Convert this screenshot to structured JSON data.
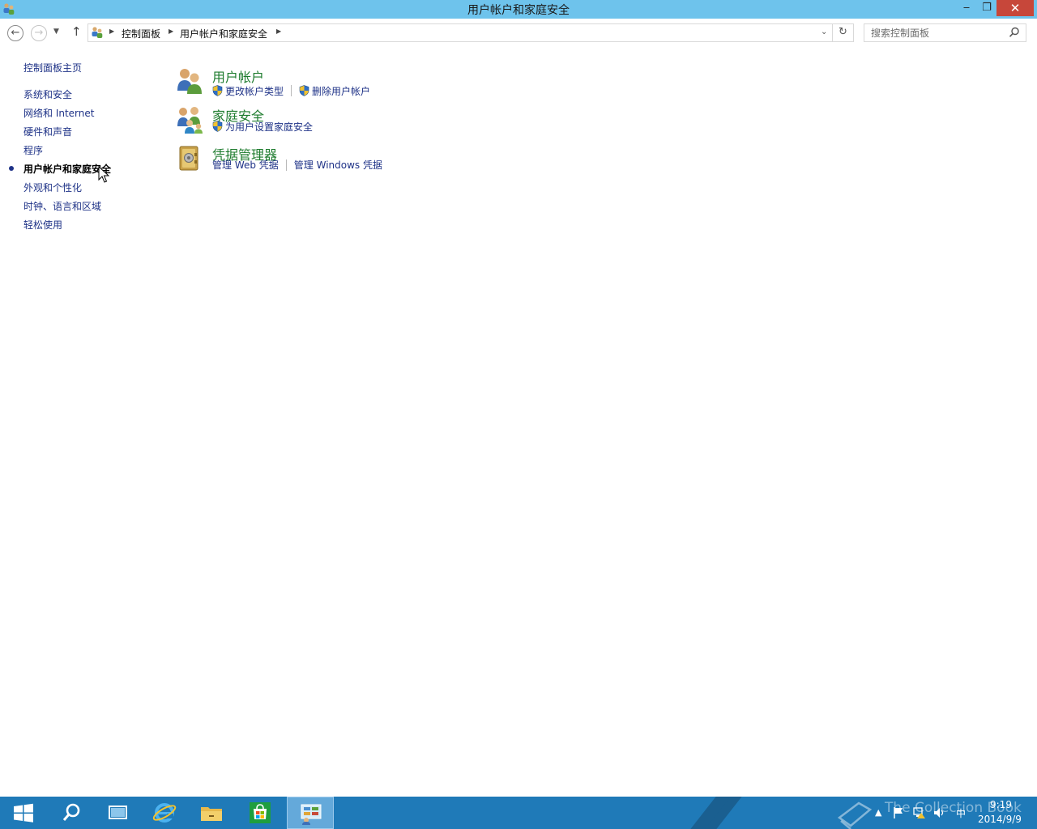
{
  "window": {
    "title": "用户帐户和家庭安全",
    "controls": {
      "minimize": "‒",
      "restore": "❐",
      "close": "✕"
    }
  },
  "navigation": {
    "back": "←",
    "forward": "→",
    "up": "↑",
    "breadcrumb": [
      "控制面板",
      "用户帐户和家庭安全"
    ],
    "search_placeholder": "搜索控制面板"
  },
  "sidebar": {
    "home": "控制面板主页",
    "items": [
      {
        "label": "系统和安全",
        "current": false
      },
      {
        "label": "网络和 Internet",
        "current": false
      },
      {
        "label": "硬件和声音",
        "current": false
      },
      {
        "label": "程序",
        "current": false
      },
      {
        "label": "用户帐户和家庭安全",
        "current": true
      },
      {
        "label": "外观和个性化",
        "current": false
      },
      {
        "label": "时钟、语言和区域",
        "current": false
      },
      {
        "label": "轻松使用",
        "current": false
      }
    ]
  },
  "categories": [
    {
      "title": "用户帐户",
      "icon": "users-icon",
      "tasks": [
        {
          "label": "更改帐户类型",
          "shield": true
        },
        {
          "label": "删除用户帐户",
          "shield": true
        }
      ]
    },
    {
      "title": "家庭安全",
      "icon": "family-safety-icon",
      "tasks": [
        {
          "label": "为用户设置家庭安全",
          "shield": true
        }
      ]
    },
    {
      "title": "凭据管理器",
      "icon": "credential-manager-icon",
      "tasks": [
        {
          "label": "管理 Web 凭据",
          "shield": false
        },
        {
          "label": "管理 Windows 凭据",
          "shield": false
        }
      ]
    }
  ],
  "taskbar": {
    "apps": [
      "start-icon",
      "search-icon",
      "task-view-icon",
      "internet-explorer-icon",
      "file-explorer-icon",
      "store-icon",
      "control-panel-icon"
    ],
    "tray": {
      "input_method": "中",
      "time": "9:19",
      "date": "2014/9/9"
    },
    "watermark": "The Collection Book"
  },
  "colors": {
    "titlebar": "#6ec3ec",
    "taskbar": "#1f7ab8",
    "link": "#1e3287",
    "category_title": "#1d7b2d",
    "close_button": "#c7473a"
  }
}
